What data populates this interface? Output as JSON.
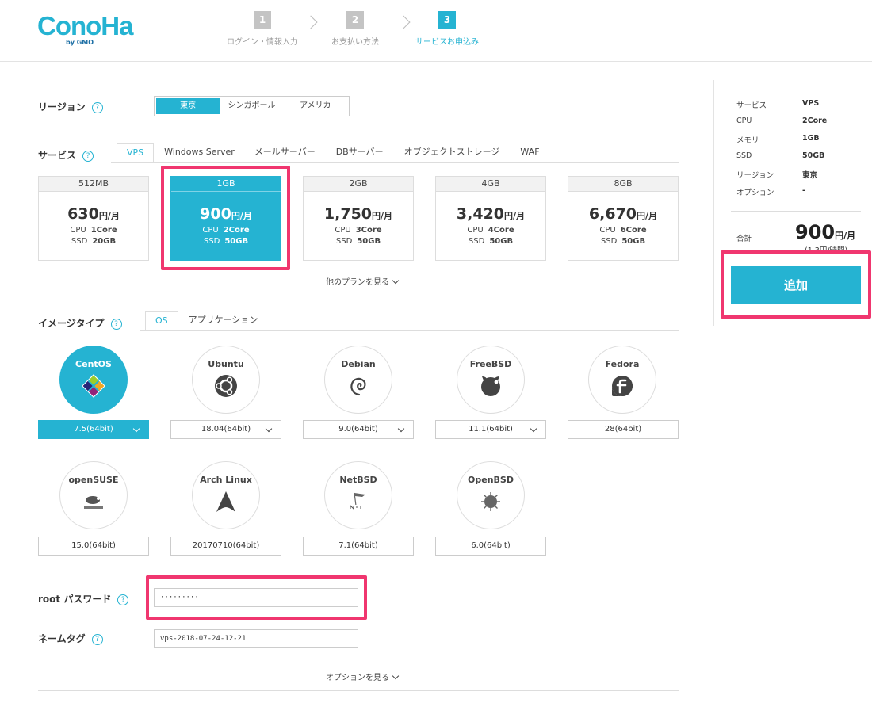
{
  "logo": {
    "text": "ConoHa",
    "sub": "by GMO"
  },
  "steps": [
    {
      "num": "1",
      "label": "ログイン・情報入力"
    },
    {
      "num": "2",
      "label": "お支払い方法"
    },
    {
      "num": "3",
      "label": "サービスお申込み"
    }
  ],
  "region": {
    "label": "リージョン",
    "options": [
      "東京",
      "シンガポール",
      "アメリカ"
    ],
    "selected": "東京"
  },
  "service": {
    "label": "サービス",
    "tabs": [
      "VPS",
      "Windows Server",
      "メールサーバー",
      "DBサーバー",
      "オブジェクトストレージ",
      "WAF"
    ],
    "active_tab": "VPS"
  },
  "plans": [
    {
      "name": "512MB",
      "price": "630",
      "unit": "円/月",
      "cpu_label": "CPU",
      "cpu": "1Core",
      "ssd_label": "SSD",
      "ssd": "20GB"
    },
    {
      "name": "1GB",
      "price": "900",
      "unit": "円/月",
      "cpu_label": "CPU",
      "cpu": "2Core",
      "ssd_label": "SSD",
      "ssd": "50GB"
    },
    {
      "name": "2GB",
      "price": "1,750",
      "unit": "円/月",
      "cpu_label": "CPU",
      "cpu": "3Core",
      "ssd_label": "SSD",
      "ssd": "50GB"
    },
    {
      "name": "4GB",
      "price": "3,420",
      "unit": "円/月",
      "cpu_label": "CPU",
      "cpu": "4Core",
      "ssd_label": "SSD",
      "ssd": "50GB"
    },
    {
      "name": "8GB",
      "price": "6,670",
      "unit": "円/月",
      "cpu_label": "CPU",
      "cpu": "6Core",
      "ssd_label": "SSD",
      "ssd": "50GB"
    }
  ],
  "selected_plan": "1GB",
  "more_plans": "他のプランを見る",
  "image_type": {
    "label": "イメージタイプ",
    "tabs": [
      "OS",
      "アプリケーション"
    ],
    "active_tab": "OS"
  },
  "os_list": [
    {
      "name": "CentOS",
      "version": "7.5(64bit)",
      "icon": "centos-icon"
    },
    {
      "name": "Ubuntu",
      "version": "18.04(64bit)",
      "icon": "ubuntu-icon"
    },
    {
      "name": "Debian",
      "version": "9.0(64bit)",
      "icon": "debian-icon"
    },
    {
      "name": "FreeBSD",
      "version": "11.1(64bit)",
      "icon": "freebsd-icon"
    },
    {
      "name": "Fedora",
      "version": "28(64bit)",
      "icon": "fedora-icon"
    },
    {
      "name": "openSUSE",
      "version": "15.0(64bit)",
      "icon": "opensuse-icon"
    },
    {
      "name": "Arch Linux",
      "version": "20170710(64bit)",
      "icon": "archlinux-icon"
    },
    {
      "name": "NetBSD",
      "version": "7.1(64bit)",
      "icon": "netbsd-icon"
    },
    {
      "name": "OpenBSD",
      "version": "6.0(64bit)",
      "icon": "openbsd-icon"
    }
  ],
  "selected_os": "CentOS",
  "root_password": {
    "label": "root パスワード",
    "value": "·········|"
  },
  "name_tag": {
    "label": "ネームタグ",
    "value": "vps-2018-07-24-12-21"
  },
  "more_options": "オプションを見る",
  "summary": {
    "rows": [
      {
        "key": "サービス",
        "value": "VPS"
      },
      {
        "key": "CPU",
        "value": "2Core"
      },
      {
        "key": "メモリ",
        "value": "1GB"
      },
      {
        "key": "SSD",
        "value": "50GB"
      },
      {
        "key": "リージョン",
        "value": "東京"
      },
      {
        "key": "オプション",
        "value": "-"
      }
    ],
    "total_label": "合計",
    "total_price": "900",
    "total_unit": "円/月",
    "hourly": "(1.3円/時間)",
    "add_button": "追加"
  },
  "colors": {
    "accent": "#25b3d2",
    "highlight": "#f0366f"
  },
  "help_icon": "?"
}
